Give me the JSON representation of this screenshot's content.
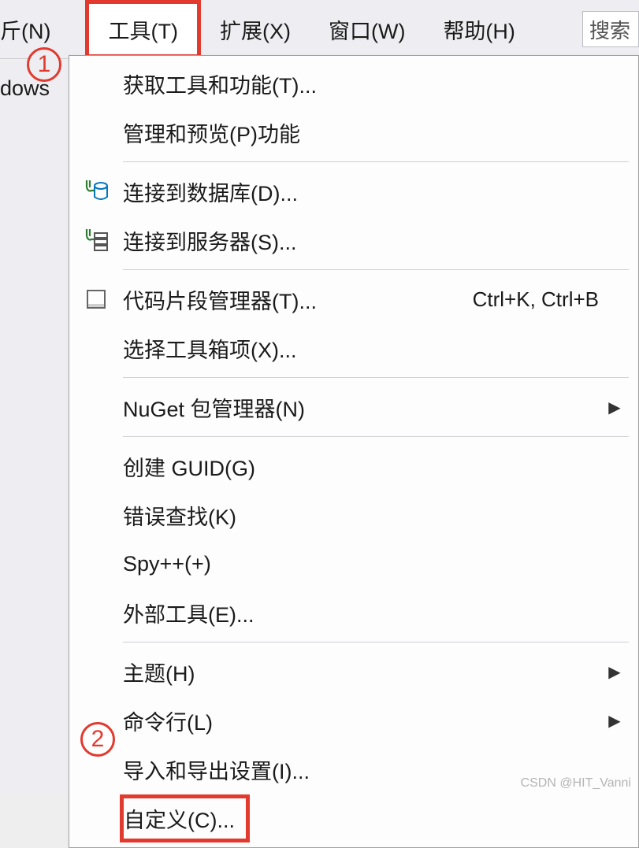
{
  "menubar": {
    "left_partial": "斤(N)",
    "tools": "工具(T)",
    "extensions": "扩展(X)",
    "window": "窗口(W)",
    "help": "帮助(H)",
    "search_value": "搜索"
  },
  "left_panel": {
    "text": "dows"
  },
  "annotations": {
    "n1": "1",
    "n2": "2"
  },
  "dropdown": {
    "get_tools": "获取工具和功能(T)...",
    "manage_preview": "管理和预览(P)功能",
    "connect_db": "连接到数据库(D)...",
    "connect_server": "连接到服务器(S)...",
    "code_snippets": "代码片段管理器(T)...",
    "code_snippets_shortcut": "Ctrl+K, Ctrl+B",
    "choose_toolbox": "选择工具箱项(X)...",
    "nuget": "NuGet 包管理器(N)",
    "create_guid": "创建 GUID(G)",
    "error_lookup": "错误查找(K)",
    "spypp": "Spy++(+)",
    "external_tools": "外部工具(E)...",
    "theme": "主题(H)",
    "command_line": "命令行(L)",
    "import_export": "导入和导出设置(I)...",
    "customize": "自定义(C)..."
  },
  "watermark": "CSDN @HIT_Vanni"
}
